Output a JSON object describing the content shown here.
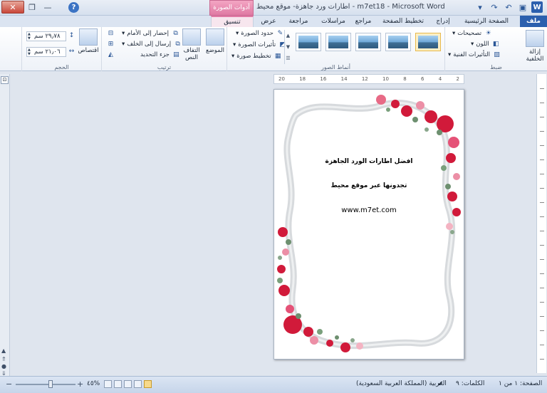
{
  "window": {
    "title": "اطارات ورد جاهزة- موقع محيط - m7et18 - Microsoft Word",
    "context_tab_header": "أدوات الصورة"
  },
  "tabs": [
    {
      "label": "ملف"
    },
    {
      "label": "الصفحة الرئيسية"
    },
    {
      "label": "إدراج"
    },
    {
      "label": "تخطيط الصفحة"
    },
    {
      "label": "مراجع"
    },
    {
      "label": "مراسلات"
    },
    {
      "label": "مراجعة"
    },
    {
      "label": "عرض"
    },
    {
      "label": "تنسيق"
    }
  ],
  "ribbon": {
    "adjust": {
      "label": "ضبط",
      "remove_bg": "إزالة الخلفية",
      "corrections": "تصحيحات",
      "color": "اللون",
      "artistic": "التأثيرات الفنية"
    },
    "styles": {
      "label": "أنماط الصور",
      "border": "حدود الصورة",
      "effects": "تأثيرات الصورة",
      "layout": "تخطيط صورة"
    },
    "arrange": {
      "label": "ترتيب",
      "position": "الموضع",
      "wrap": "التفاف النص",
      "forward": "إحضار إلى الأمام",
      "backward": "إرسال إلى الخلف",
      "selection": "جزء التحديد"
    },
    "size": {
      "label": "الحجم",
      "crop": "اقتصاص",
      "height": "٢٩٫٧٨ سم",
      "width": "٢١٫٠٦ سم"
    }
  },
  "ruler": {
    "labels": [
      "20",
      "18",
      "16",
      "14",
      "12",
      "10",
      "8",
      "6",
      "4",
      "2"
    ]
  },
  "document": {
    "line1": "افضل اطارات الورد الجاهزة",
    "line2": "تجدونها عبر موقع محيط",
    "line3": "www.m7et.com"
  },
  "status": {
    "page": "الصفحة: ١ من ١",
    "words": "الكلمات: ٩",
    "language": "العربية (المملكة العربية السعودية)",
    "zoom": "٤٥%"
  },
  "colors": {
    "accent": "#2b5fae",
    "context_tab": "#e07aa4",
    "flower": "#d11a3a"
  }
}
